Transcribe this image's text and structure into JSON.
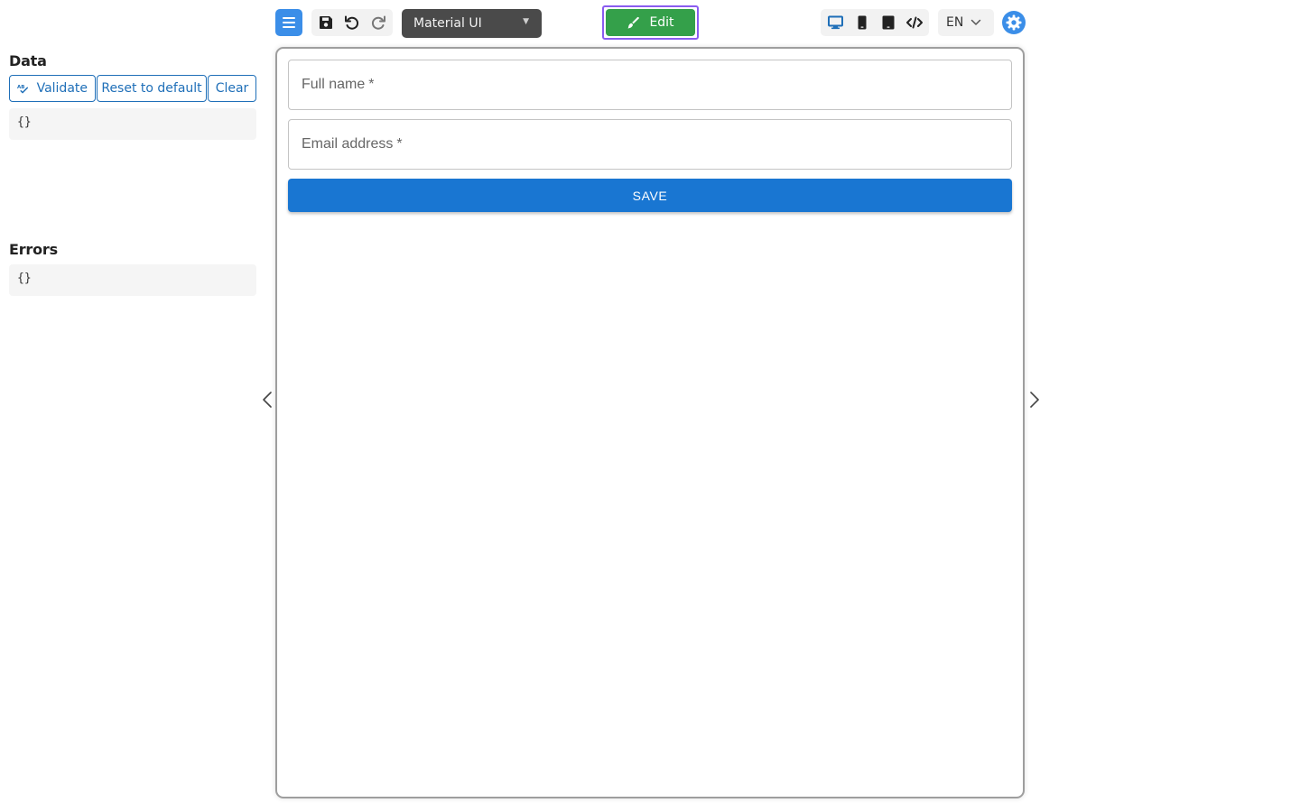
{
  "toolbar": {
    "menu_icon": "hamburger-menu-icon",
    "save_icon": "floppy-disk-icon",
    "undo_icon": "undo-icon",
    "redo_icon": "redo-icon",
    "theme": "Material UI",
    "edit_label": "Edit",
    "devices": [
      "desktop-icon",
      "mobile-icon",
      "tablet-icon",
      "code-icon"
    ],
    "language": "EN",
    "settings_icon": "settings-gear-icon"
  },
  "left_panel": {
    "data_title": "Data",
    "validate_label": "Validate",
    "reset_label": "Reset to default",
    "clear_label": "Clear",
    "data_value": "{}",
    "errors_title": "Errors",
    "errors_value": "{}"
  },
  "form": {
    "full_name_label": "Full name",
    "email_label": "Email address",
    "required_marker": "*",
    "save_label": "SAVE"
  },
  "colors": {
    "accent_blue": "#3b8ee8",
    "edit_green": "#34a04a",
    "edit_outline": "#8a5cf0",
    "save_blue": "#1976d2",
    "link_blue": "#1f6fb8"
  }
}
